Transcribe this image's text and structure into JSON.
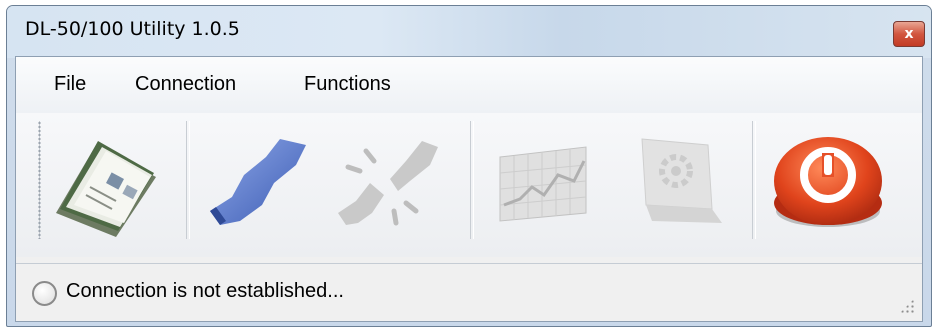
{
  "window": {
    "title": "DL-50/100 Utility 1.0.5",
    "close_label": "x"
  },
  "menu": {
    "items": [
      {
        "label": "File"
      },
      {
        "label": "Connection"
      },
      {
        "label": "Functions"
      }
    ]
  },
  "toolbar": {
    "buttons": [
      {
        "icon": "open-file-icon",
        "enabled": true
      },
      {
        "icon": "connect-icon",
        "enabled": true
      },
      {
        "icon": "disconnect-icon",
        "enabled": false
      },
      {
        "icon": "chart-icon",
        "enabled": false
      },
      {
        "icon": "settings-icon",
        "enabled": false
      },
      {
        "icon": "power-exit-icon",
        "enabled": true
      }
    ]
  },
  "status": {
    "text": "Connection is not established..."
  },
  "colors": {
    "connect_blue": "#4f73c8",
    "disabled_gray": "#c8c8c8",
    "power_red": "#d84420"
  }
}
